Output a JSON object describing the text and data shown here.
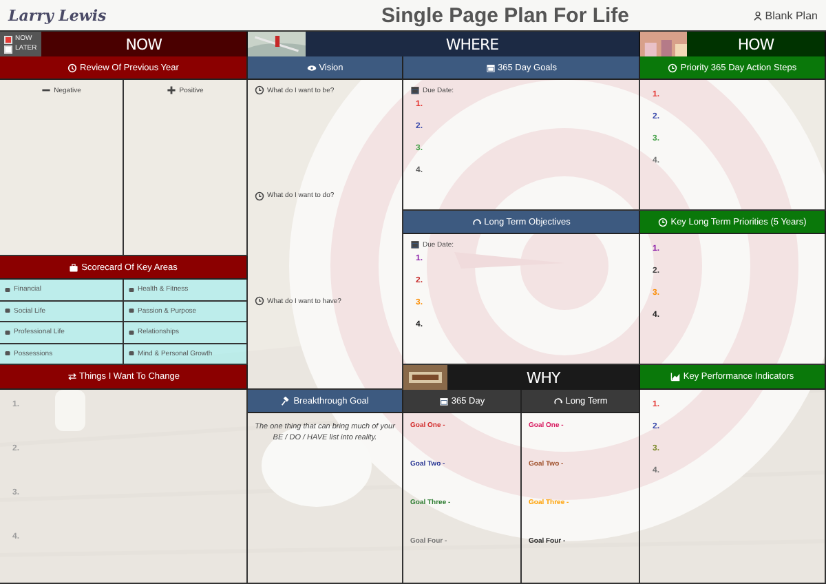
{
  "header": {
    "logo": "Larry Lewis",
    "title": "Single Page Plan For Life",
    "plan_button": "Blank Plan"
  },
  "legend": [
    {
      "label": "NOW",
      "color": "#e53935"
    },
    {
      "label": "LATER",
      "color": "#ffffff"
    }
  ],
  "bands": {
    "now": "NOW",
    "where": "WHERE",
    "how": "HOW",
    "why": "WHY"
  },
  "review": {
    "title": "Review Of Previous Year",
    "columns": [
      "Negative",
      "Positive"
    ]
  },
  "scorecard": {
    "title": "Scorecard Of Key Areas",
    "areas": [
      "Financial",
      "Health & Fitness",
      "Social Life",
      "Passion & Purpose",
      "Professional Life",
      "Relationships",
      "Possessions",
      "Mind & Personal Growth"
    ]
  },
  "things_to_change": {
    "title": "Things I Want To Change",
    "items": [
      {
        "label": "1.",
        "color": "#9e9e9e"
      },
      {
        "label": "2.",
        "color": "#9e9e9e"
      },
      {
        "label": "3.",
        "color": "#9e9e9e"
      },
      {
        "label": "4.",
        "color": "#9e9e9e"
      }
    ]
  },
  "vision": {
    "title": "Vision",
    "questions": [
      "What do I want to be?",
      "What do I want to do?",
      "What do I want to have?"
    ]
  },
  "breakthrough": {
    "title": "Breakthrough Goal",
    "text": "The one thing that can bring much of your BE / DO / HAVE list into reality."
  },
  "goals_365": {
    "title": "365 Day Goals",
    "due_label": "Due Date:",
    "items": [
      {
        "label": "1.",
        "color": "#e53935"
      },
      {
        "label": "2.",
        "color": "#3949ab"
      },
      {
        "label": "3.",
        "color": "#43a047"
      },
      {
        "label": "4.",
        "color": "#616161"
      }
    ]
  },
  "long_term_objectives": {
    "title": "Long Term Objectives",
    "due_label": "Due Date:",
    "items": [
      {
        "label": "1.",
        "color": "#8e24aa"
      },
      {
        "label": "2.",
        "color": "#c62828"
      },
      {
        "label": "3.",
        "color": "#fb8c00"
      },
      {
        "label": "4.",
        "color": "#212121"
      }
    ]
  },
  "priority_steps": {
    "title": "Priority 365 Day Action Steps",
    "items": [
      {
        "label": "1.",
        "color": "#e53935"
      },
      {
        "label": "2.",
        "color": "#3949ab"
      },
      {
        "label": "3.",
        "color": "#43a047"
      },
      {
        "label": "4.",
        "color": "#757575"
      }
    ]
  },
  "key_priorities": {
    "title": "Key Long Term Priorities (5 Years)",
    "items": [
      {
        "label": "1.",
        "color": "#8e24aa"
      },
      {
        "label": "2.",
        "color": "#424242"
      },
      {
        "label": "3.",
        "color": "#fb8c00"
      },
      {
        "label": "4.",
        "color": "#212121"
      }
    ]
  },
  "kpi": {
    "title": "Key Performance Indicators",
    "items": [
      {
        "label": "1.",
        "color": "#e53935"
      },
      {
        "label": "2.",
        "color": "#3949ab"
      },
      {
        "label": "3.",
        "color": "#7c8a2a"
      },
      {
        "label": "4.",
        "color": "#757575"
      }
    ]
  },
  "why": {
    "columns": [
      {
        "title": "365 Day",
        "goals": [
          {
            "label": "Goal One -",
            "color": "#d32f2f"
          },
          {
            "label": "Goal Two -",
            "color": "#283593"
          },
          {
            "label": "Goal Three -",
            "color": "#2e7d32"
          },
          {
            "label": "Goal Four -",
            "color": "#757575"
          }
        ]
      },
      {
        "title": "Long Term",
        "goals": [
          {
            "label": "Goal One -",
            "color": "#d81b60"
          },
          {
            "label": "Goal Two -",
            "color": "#a0522d"
          },
          {
            "label": "Goal Three -",
            "color": "#ffa000"
          },
          {
            "label": "Goal Four -",
            "color": "#212121"
          }
        ]
      }
    ]
  }
}
